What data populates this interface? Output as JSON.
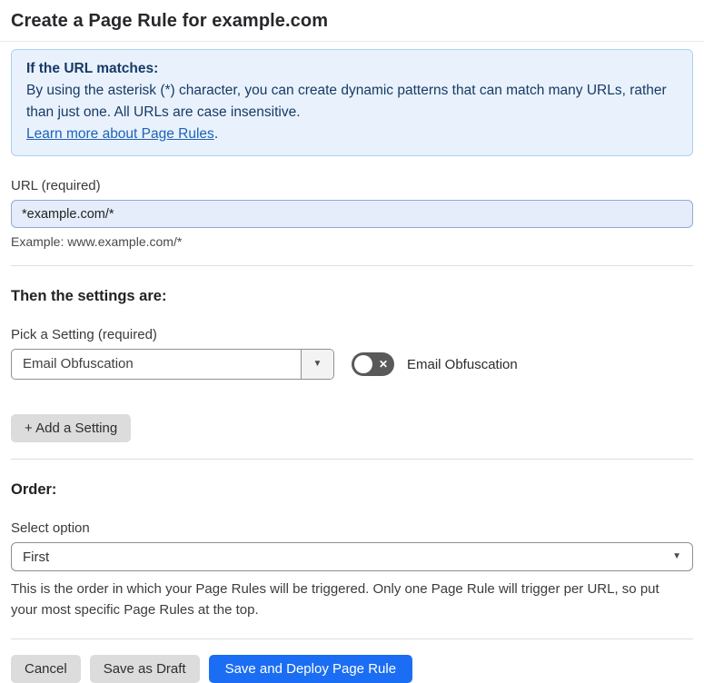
{
  "page": {
    "title": "Create a Page Rule for example.com"
  },
  "colors": {
    "primary_button": "#1b6ef3",
    "info_background": "#e9f2fc",
    "info_border": "#abd3f1",
    "info_text": "#173a66",
    "link": "#1e62b8",
    "url_input_background": "#e5edfb",
    "toggle_off": "#595959",
    "secondary_button": "#dcdcdc"
  },
  "icons": {
    "dropdown_arrow": "▼",
    "toggle_off_glyph": "✕"
  },
  "info_box": {
    "heading": "If the URL matches:",
    "body": "By using the asterisk (*) character, you can create dynamic patterns that can match many URLs, rather than just one. All URLs are case insensitive.",
    "link": "Learn more about Page Rules",
    "link_suffix": "."
  },
  "url_section": {
    "label": "URL (required)",
    "value": "*example.com/*",
    "example": "Example: www.example.com/*"
  },
  "settings_section": {
    "heading": "Then the settings are:",
    "pick_label": "Pick a Setting (required)",
    "selected_setting": "Email Obfuscation",
    "toggle": {
      "state": "off",
      "label": "Email Obfuscation"
    },
    "add_button": "+ Add a Setting"
  },
  "order_section": {
    "heading": "Order:",
    "label": "Select option",
    "selected": "First",
    "help": "This is the order in which your Page Rules will be triggered. Only one Page Rule will trigger per URL, so put your most specific Page Rules at the top."
  },
  "footer": {
    "cancel": "Cancel",
    "save_draft": "Save as Draft",
    "save_deploy": "Save and Deploy Page Rule"
  }
}
